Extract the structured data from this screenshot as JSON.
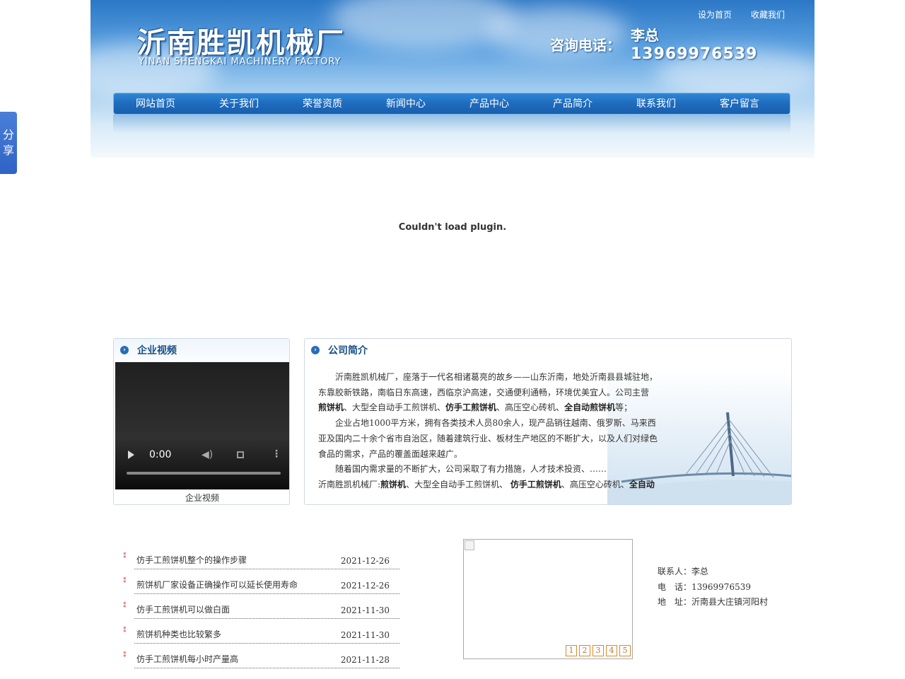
{
  "share": {
    "chars": [
      "分",
      "享"
    ]
  },
  "header": {
    "logo_cn": "沂南胜凯机械厂",
    "logo_en": "YINAN SHENGKAI MACHINERY FACTORY",
    "top_links": [
      "设为首页",
      "收藏我们"
    ],
    "phone_label": "咨询电话：",
    "phone_name": "李总",
    "phone_number": "13969976539"
  },
  "nav": [
    "网站首页",
    "关于我们",
    "荣誉资质",
    "新闻中心",
    "产品中心",
    "产品简介",
    "联系我们",
    "客户留言"
  ],
  "plugin_message": "Couldn't load plugin.",
  "video_box": {
    "title": "企业视频",
    "time": "0:00",
    "caption": "企业视频"
  },
  "intro_box": {
    "title": "公司简介",
    "p1_a": "沂南胜凯机械厂，座落于一代名相诸葛亮的故乡——山东沂南，地处沂南县县城驻地，东靠胶新铁路，南临日东高速，西临京沪高速，交通便利通畅，环境优美宜人。公司主营",
    "p1_b1": "煎饼机",
    "p1_c": "、大型全自动手工煎饼机、",
    "p1_b2": "仿手工煎饼机",
    "p1_d": "、高压空心砖机、",
    "p1_b3": "全自动煎饼机",
    "p1_e": "等；",
    "p2": "企业占地1000平方米，拥有各类技术人员80余人，现产品销往越南、俄罗斯、马来西亚及国内二十余个省市自治区，随着建筑行业、板材生产地区的不断扩大，以及人们对绿色食品的需求，产品的覆盖面越来越广。",
    "p3": "随着国内需求量的不断扩大，公司采取了有力措施，人才技术投资、……",
    "p4_a": "沂南胜凯机械厂:",
    "p4_b1": "煎饼机",
    "p4_c": "、大型全自动手工煎饼机、 ",
    "p4_b2": "仿手工煎饼机",
    "p4_d": "、高压空心砖机、",
    "p4_b3": "全自动"
  },
  "news": [
    {
      "title": "仿手工煎饼机整个的操作步骤",
      "date": "2021-12-26"
    },
    {
      "title": "煎饼机厂家设备正确操作可以延长使用寿命",
      "date": "2021-12-26"
    },
    {
      "title": "仿手工煎饼机可以做白面",
      "date": "2021-11-30"
    },
    {
      "title": "煎饼机种类也比较繁多",
      "date": "2021-11-30"
    },
    {
      "title": "仿手工煎饼机每小时产量高",
      "date": "2021-11-28"
    }
  ],
  "slider": {
    "pages": [
      "1",
      "2",
      "3",
      "4",
      "5"
    ]
  },
  "contact": {
    "person": "联系人：李总",
    "phone": "电　话：13969976539",
    "address": "地　址：沂南县大庄镇河阳村"
  }
}
